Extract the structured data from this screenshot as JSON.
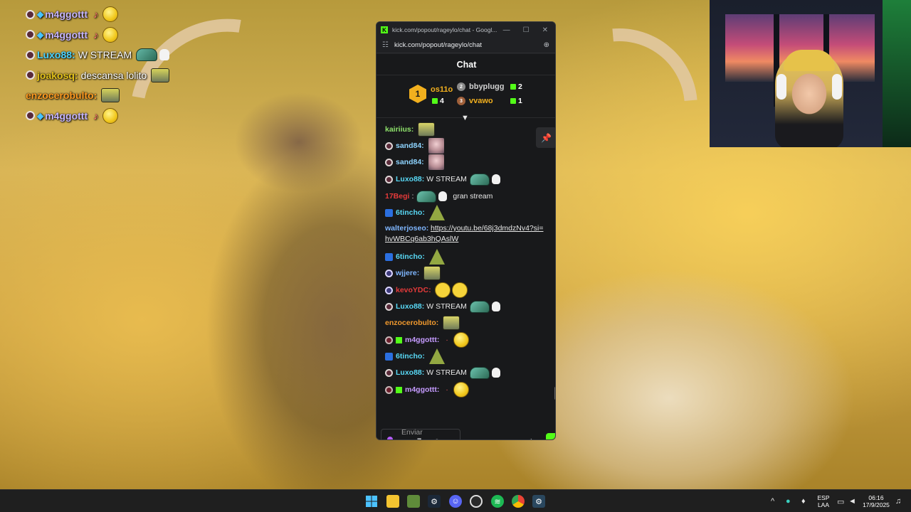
{
  "overlay": {
    "lines": [
      {
        "user": "m4ggottt",
        "message": ""
      },
      {
        "user": "m4ggottt",
        "message": ""
      },
      {
        "user": "Luxo88:",
        "message": "W STREAM"
      },
      {
        "user": "joakosq:",
        "message": "descansa lolito"
      },
      {
        "user": "enzocerobulto:",
        "message": ""
      },
      {
        "user": "m4ggottt",
        "message": ""
      }
    ]
  },
  "browser": {
    "title": "kick.com/popout/rageylo/chat - Googl...",
    "url": "kick.com/popout/rageylo/chat",
    "window_controls": {
      "minimize": "—",
      "maximize": "☐",
      "close": "✕"
    }
  },
  "chat": {
    "header": "Chat",
    "leaderboard": {
      "first": {
        "rank": "1",
        "name": "os11o",
        "count": "4"
      },
      "second": {
        "rank": "2",
        "name": "bbyplugg",
        "count": "2"
      },
      "third": {
        "rank": "3",
        "name": "vvawo",
        "count": "1"
      }
    },
    "messages": [
      {
        "user": "kairiius:",
        "text": ""
      },
      {
        "user": "sand84:",
        "text": ""
      },
      {
        "user": "sand84:",
        "text": ""
      },
      {
        "user": "Luxo88:",
        "text": "W STREAM"
      },
      {
        "user": "17Begi",
        "text": "gran stream"
      },
      {
        "user": "6tincho:",
        "text": ""
      },
      {
        "user": "walterjoseo:",
        "text": "https://youtu.be/68j3dmdzNv4?si=hvWBCq6ab3hQAslW"
      },
      {
        "user": "6tincho:",
        "text": ""
      },
      {
        "user": "wjjere:",
        "text": ""
      },
      {
        "user": "kevoYDC:",
        "text": ""
      },
      {
        "user": "Luxo88:",
        "text": "W STREAM"
      },
      {
        "user": "enzocerobulto:",
        "text": ""
      },
      {
        "user": "m4ggottt:",
        "text": ""
      },
      {
        "user": "6tincho:",
        "text": ""
      },
      {
        "user": "Luxo88:",
        "text": "W STREAM"
      },
      {
        "user": "m4ggottt:",
        "text": ""
      }
    ],
    "input": {
      "placeholder_line1": "Enviar",
      "placeholder_line2": "un",
      "placeholder_line3": "mensaje"
    },
    "send_label": "C"
  },
  "taskbar": {
    "lang_top": "ESP",
    "lang_bottom": "LAA",
    "time": "06:16",
    "date": "17/9/2025"
  },
  "colors": {
    "kick_green": "#53fc18",
    "chat_bg": "#18191b",
    "gold": "#f2b01e"
  }
}
